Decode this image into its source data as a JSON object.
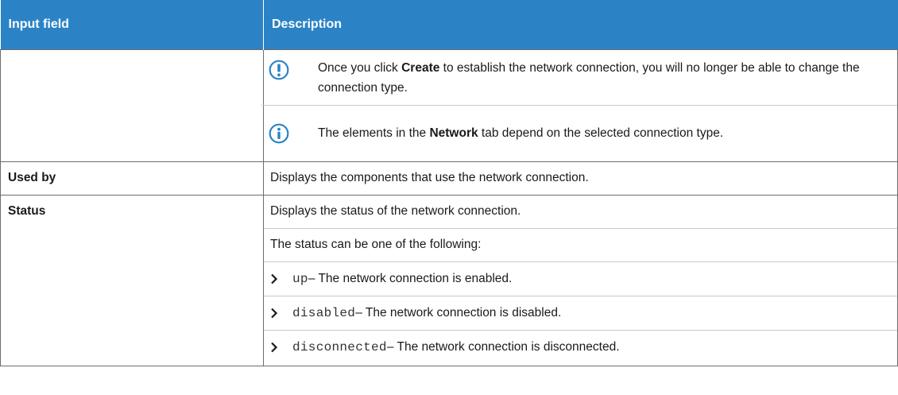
{
  "header": {
    "col1": "Input field",
    "col2": "Description"
  },
  "notes": [
    {
      "icon": "warning-icon",
      "text_before": "Once you click ",
      "bold": "Create",
      "text_after": " to establish the network connection, you will no longer be able to change the connection type."
    },
    {
      "icon": "info-icon",
      "text_before": "The elements in the ",
      "bold": "Network",
      "text_after": " tab depend on the selected connection type."
    }
  ],
  "rows": {
    "used_by": {
      "field": "Used by",
      "description": "Displays the components that use the network connection."
    },
    "status": {
      "field": "Status",
      "description": "Displays the status of the network connection.",
      "intro": "The status can be one of the following:",
      "items": [
        {
          "code": "up",
          "text": " – The network connection is enabled."
        },
        {
          "code": "disabled",
          "text": " – The network connection is disabled."
        },
        {
          "code": "disconnected",
          "text": " – The network connection is disconnected."
        }
      ]
    }
  },
  "colors": {
    "header_bg": "#2b83c6",
    "icon_blue": "#2b83c6"
  }
}
